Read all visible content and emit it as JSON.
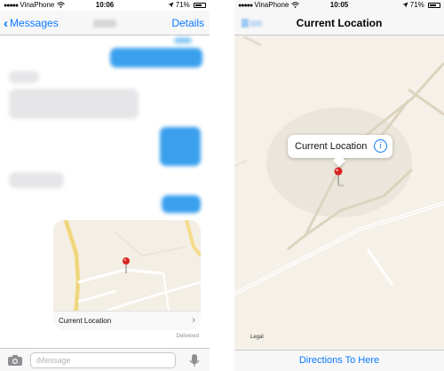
{
  "left_screen": {
    "status_bar": {
      "carrier": "VinaPhone",
      "signal": "●●●●●",
      "time": "10:06",
      "battery": "71%",
      "battery_level": 0.71
    },
    "nav": {
      "back_label": "Messages",
      "details_label": "Details"
    },
    "map_preview": {
      "label": "Current Location"
    },
    "delivered_label": "Delivered",
    "input": {
      "placeholder": "iMessage"
    },
    "icons": {
      "back": "chevron-left-icon",
      "camera": "camera-icon",
      "mic": "microphone-icon",
      "pin": "map-pin-icon",
      "wifi": "wifi-icon",
      "location": "location-arrow-icon"
    }
  },
  "right_screen": {
    "status_bar": {
      "carrier": "VinaPhone",
      "signal": "●●●●●",
      "time": "10:05",
      "battery": "71%",
      "battery_level": 0.71
    },
    "nav": {
      "title": "Current Location"
    },
    "callout": {
      "title": "Current Location",
      "info_glyph": "i"
    },
    "legal_label": "Legal",
    "directions_label": "Directions To Here"
  },
  "colors": {
    "accent": "#0a7aff",
    "bubble_sent": "#3aa0ee",
    "bubble_received": "#e6e6e9",
    "map_background": "#f4efe5",
    "pin": "#d9241f"
  }
}
